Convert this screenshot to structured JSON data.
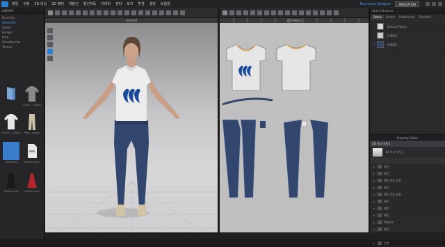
{
  "menubar": {
    "items": [
      "파일",
      "수정",
      "3D 의상",
      "2D 패턴",
      "재봉선",
      "횡선자동",
      "아바타",
      "렌더",
      "보기",
      "환경",
      "설정",
      "도움말"
    ],
    "link": "Marvelous Designer",
    "badge": "SIMULATION"
  },
  "library": {
    "title": "LIBRARY",
    "nav": [
      "Favorites",
      "Garments",
      "Avatar",
      "Hanger",
      "Pose",
      "Shoulder Pad",
      "Texture"
    ],
    "active_index": 1,
    "thumbs": [
      {
        "label": "",
        "kind": "folder"
      },
      {
        "label": "T-shirt_...(pose)",
        "kind": "tee"
      },
      {
        "label": "T-shirt_...(pose)",
        "kind": "tee-white"
      },
      {
        "label": "Pant...(pose)",
        "kind": "pants"
      },
      {
        "label": "steem.jpg",
        "kind": "blue"
      },
      {
        "label": "default.zpac",
        "kind": "zpac"
      },
      {
        "label": "default.zpac",
        "kind": "black"
      },
      {
        "label": "default.zpac",
        "kind": "red"
      }
    ]
  },
  "view3d": {
    "tab": "Untitled"
  },
  "view2d": {
    "tab": "2D Pattern"
  },
  "right_panel": {
    "title": "Object Browser",
    "tabs": [
      "Fabric",
      "Button",
      "Buttonhole",
      "Topstitch"
    ],
    "fabrics": [
      {
        "name": "Default Fabric",
        "swatch": "#d6d6d6",
        "checked": false
      },
      {
        "name": "FABRIC",
        "swatch": "#c9c9cb",
        "checked": false
      },
      {
        "name": "FABRIC",
        "swatch": "#34456a",
        "checked": true
      }
    ],
    "section": "Property Editor",
    "prop_rows": [
      {
        "label": "3D 의상 가게 1",
        "selected": true
      }
    ],
    "preview_label": "3D 의상 가게_1",
    "tree_rows": [
      "패턴",
      "패턴",
      "패턴 자동 맞춤",
      "패턴",
      "패턴 자동 맞춤",
      "패턴",
      "패턴",
      "패턴",
      "Pattern",
      "패턴",
      "패턴",
      "선택"
    ]
  },
  "colors": {
    "accent": "#2f7fd1",
    "denim": "#33466e",
    "shirt": "#ececec",
    "logo": "#1c4a9a"
  }
}
